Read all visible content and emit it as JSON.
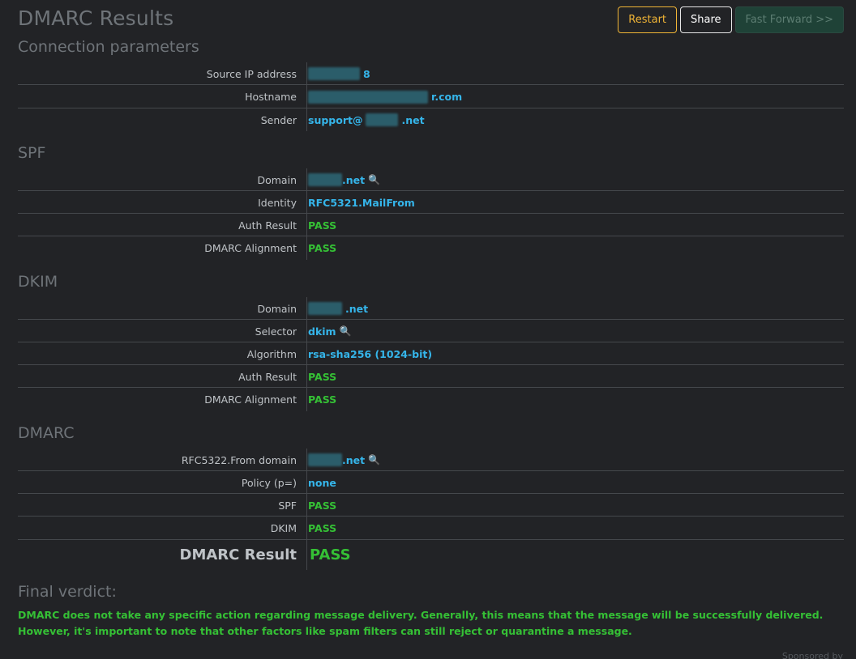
{
  "title": "DMARC Results",
  "toolbar": {
    "restart": "Restart",
    "share": "Share",
    "fast_forward": "Fast Forward >>"
  },
  "connection": {
    "title": "Connection parameters",
    "rows": [
      {
        "label": "Source IP address",
        "value": "8"
      },
      {
        "label": "Hostname",
        "value": "r.com"
      },
      {
        "label": "Sender",
        "value_prefix": "support@",
        "value": ".net"
      }
    ]
  },
  "spf": {
    "title": "SPF",
    "rows": [
      {
        "label": "Domain",
        "value": ".net",
        "icon": "search-icon"
      },
      {
        "label": "Identity",
        "value": "RFC5321.MailFrom"
      },
      {
        "label": "Auth Result",
        "value": "PASS"
      },
      {
        "label": "DMARC Alignment",
        "value": "PASS"
      }
    ]
  },
  "dkim": {
    "title": "DKIM",
    "rows": [
      {
        "label": "Domain",
        "value": ".net"
      },
      {
        "label": "Selector",
        "value": "dkim",
        "icon": "search-icon"
      },
      {
        "label": "Algorithm",
        "value": "rsa-sha256 (1024-bit)"
      },
      {
        "label": "Auth Result",
        "value": "PASS"
      },
      {
        "label": "DMARC Alignment",
        "value": "PASS"
      }
    ]
  },
  "dmarc": {
    "title": "DMARC",
    "rows": [
      {
        "label": "RFC5322.From domain",
        "value": ".net",
        "icon": "search-icon"
      },
      {
        "label": "Policy (p=)",
        "value": "none"
      },
      {
        "label": "SPF",
        "value": "PASS"
      },
      {
        "label": "DKIM",
        "value": "PASS"
      }
    ],
    "result_label": "DMARC Result",
    "result_value": "PASS"
  },
  "verdict": {
    "title": "Final verdict:",
    "text": "DMARC does not take any specific action regarding message delivery. Generally, this means that the message will be successfully delivered. However, it's important to note that other factors like spam filters can still reject or quarantine a message."
  },
  "footer": {
    "sponsored": "Sponsored by"
  },
  "colors": {
    "background": "#222326",
    "link_blue": "#35b5ea",
    "pass_green": "#35c035",
    "restart_amber": "#f1b536"
  }
}
